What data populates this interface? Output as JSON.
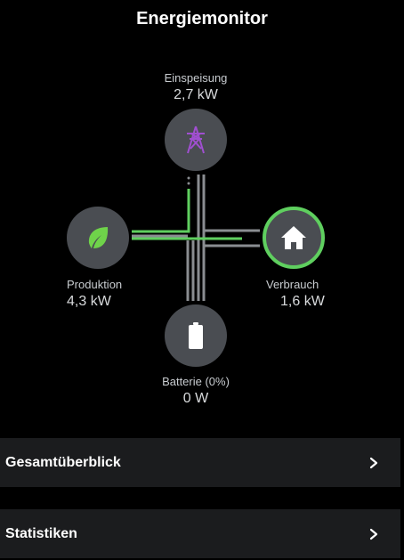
{
  "header": {
    "title": "Energiemonitor"
  },
  "nodes": {
    "grid": {
      "label": "Einspeisung",
      "value": "2,7 kW",
      "icon": "transmission-tower-icon",
      "icon_color": "#a04fd0"
    },
    "solar": {
      "label": "Produktion",
      "value": "4,3 kW",
      "icon": "leaf-icon",
      "icon_color": "#6fd34a"
    },
    "home": {
      "label": "Verbrauch",
      "value": "1,6 kW",
      "icon": "house-icon",
      "icon_color": "#ffffff",
      "ring_color": "#5fcf5f"
    },
    "battery": {
      "label": "Batterie (0%)",
      "value": "0 W",
      "icon": "battery-icon",
      "icon_color": "#ffffff"
    }
  },
  "colors": {
    "background": "#000000",
    "node_fill": "#4a4d52",
    "active_flow": "#5fcf5f",
    "idle_flow": "#8a8d91",
    "panel_bg": "#1b1c1e"
  },
  "panels": [
    {
      "label": "Gesamtüberblick"
    },
    {
      "label": "Statistiken"
    }
  ]
}
